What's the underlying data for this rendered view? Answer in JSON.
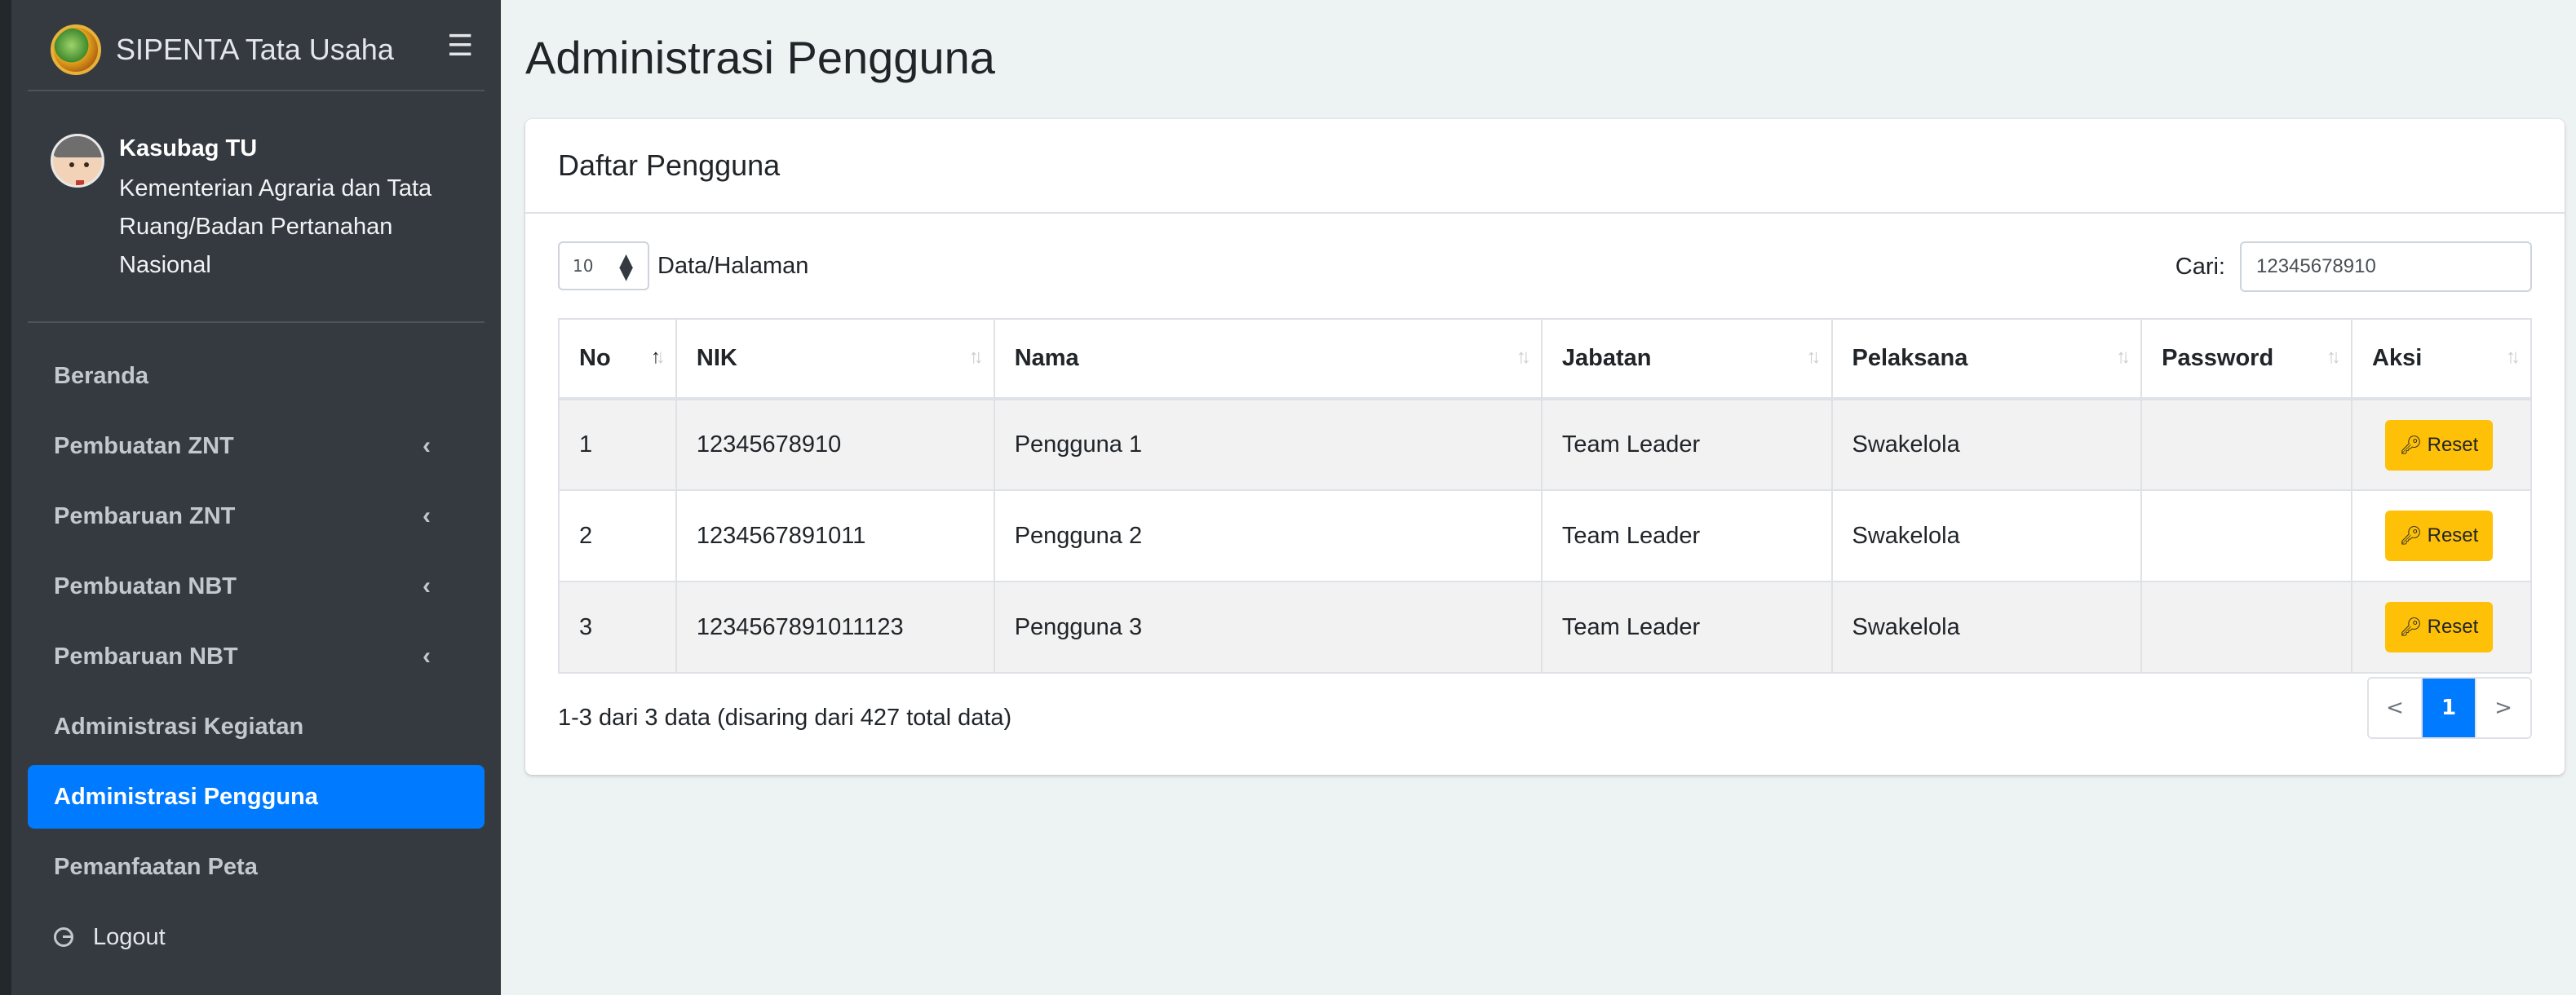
{
  "brand": {
    "title": "SIPENTA Tata Usaha",
    "logo_icon": "globe-logo-icon",
    "menu_icon": "hamburger-icon"
  },
  "user": {
    "role": "Kasubag TU",
    "org": "Kementerian Agraria dan Tata Ruang/Badan Pertanahan Nasional"
  },
  "nav": {
    "items": [
      {
        "label": "Beranda",
        "has_submenu": false
      },
      {
        "label": "Pembuatan ZNT",
        "has_submenu": true
      },
      {
        "label": "Pembaruan ZNT",
        "has_submenu": true
      },
      {
        "label": "Pembuatan NBT",
        "has_submenu": true
      },
      {
        "label": "Pembaruan NBT",
        "has_submenu": true
      },
      {
        "label": "Administrasi Kegiatan",
        "has_submenu": false
      },
      {
        "label": "Administrasi Pengguna",
        "has_submenu": false,
        "active": true
      },
      {
        "label": "Pemanfaatan Peta",
        "has_submenu": false
      }
    ],
    "logout": "Logout",
    "chevron": "‹"
  },
  "page": {
    "title": "Administrasi Pengguna"
  },
  "card": {
    "title": "Daftar Pengguna"
  },
  "table_controls": {
    "length_value": "10",
    "length_label": "Data/Halaman",
    "search_label": "Cari:",
    "search_value": "12345678910"
  },
  "table": {
    "columns": [
      "No",
      "NIK",
      "Nama",
      "Jabatan",
      "Pelaksana",
      "Password",
      "Aksi"
    ],
    "rows": [
      {
        "no": "1",
        "nik": "12345678910",
        "nama": "Pengguna 1",
        "jabatan": "Team Leader",
        "pelaksana": "Swakelola",
        "password": "",
        "action": "Reset"
      },
      {
        "no": "2",
        "nik": "1234567891011",
        "nama": "Pengguna 2",
        "jabatan": "Team Leader",
        "pelaksana": "Swakelola",
        "password": "",
        "action": "Reset"
      },
      {
        "no": "3",
        "nik": "1234567891011123",
        "nama": "Pengguna 3",
        "jabatan": "Team Leader",
        "pelaksana": "Swakelola",
        "password": "",
        "action": "Reset"
      }
    ]
  },
  "footer": {
    "info": "1-3 dari 3 data (disaring dari 427 total data)",
    "prev": "<",
    "current_page": "1",
    "next": ">"
  },
  "colors": {
    "sidebar": "#343a40",
    "active": "#007bff",
    "reset_button": "#ffc107",
    "background": "#edf2f3"
  }
}
